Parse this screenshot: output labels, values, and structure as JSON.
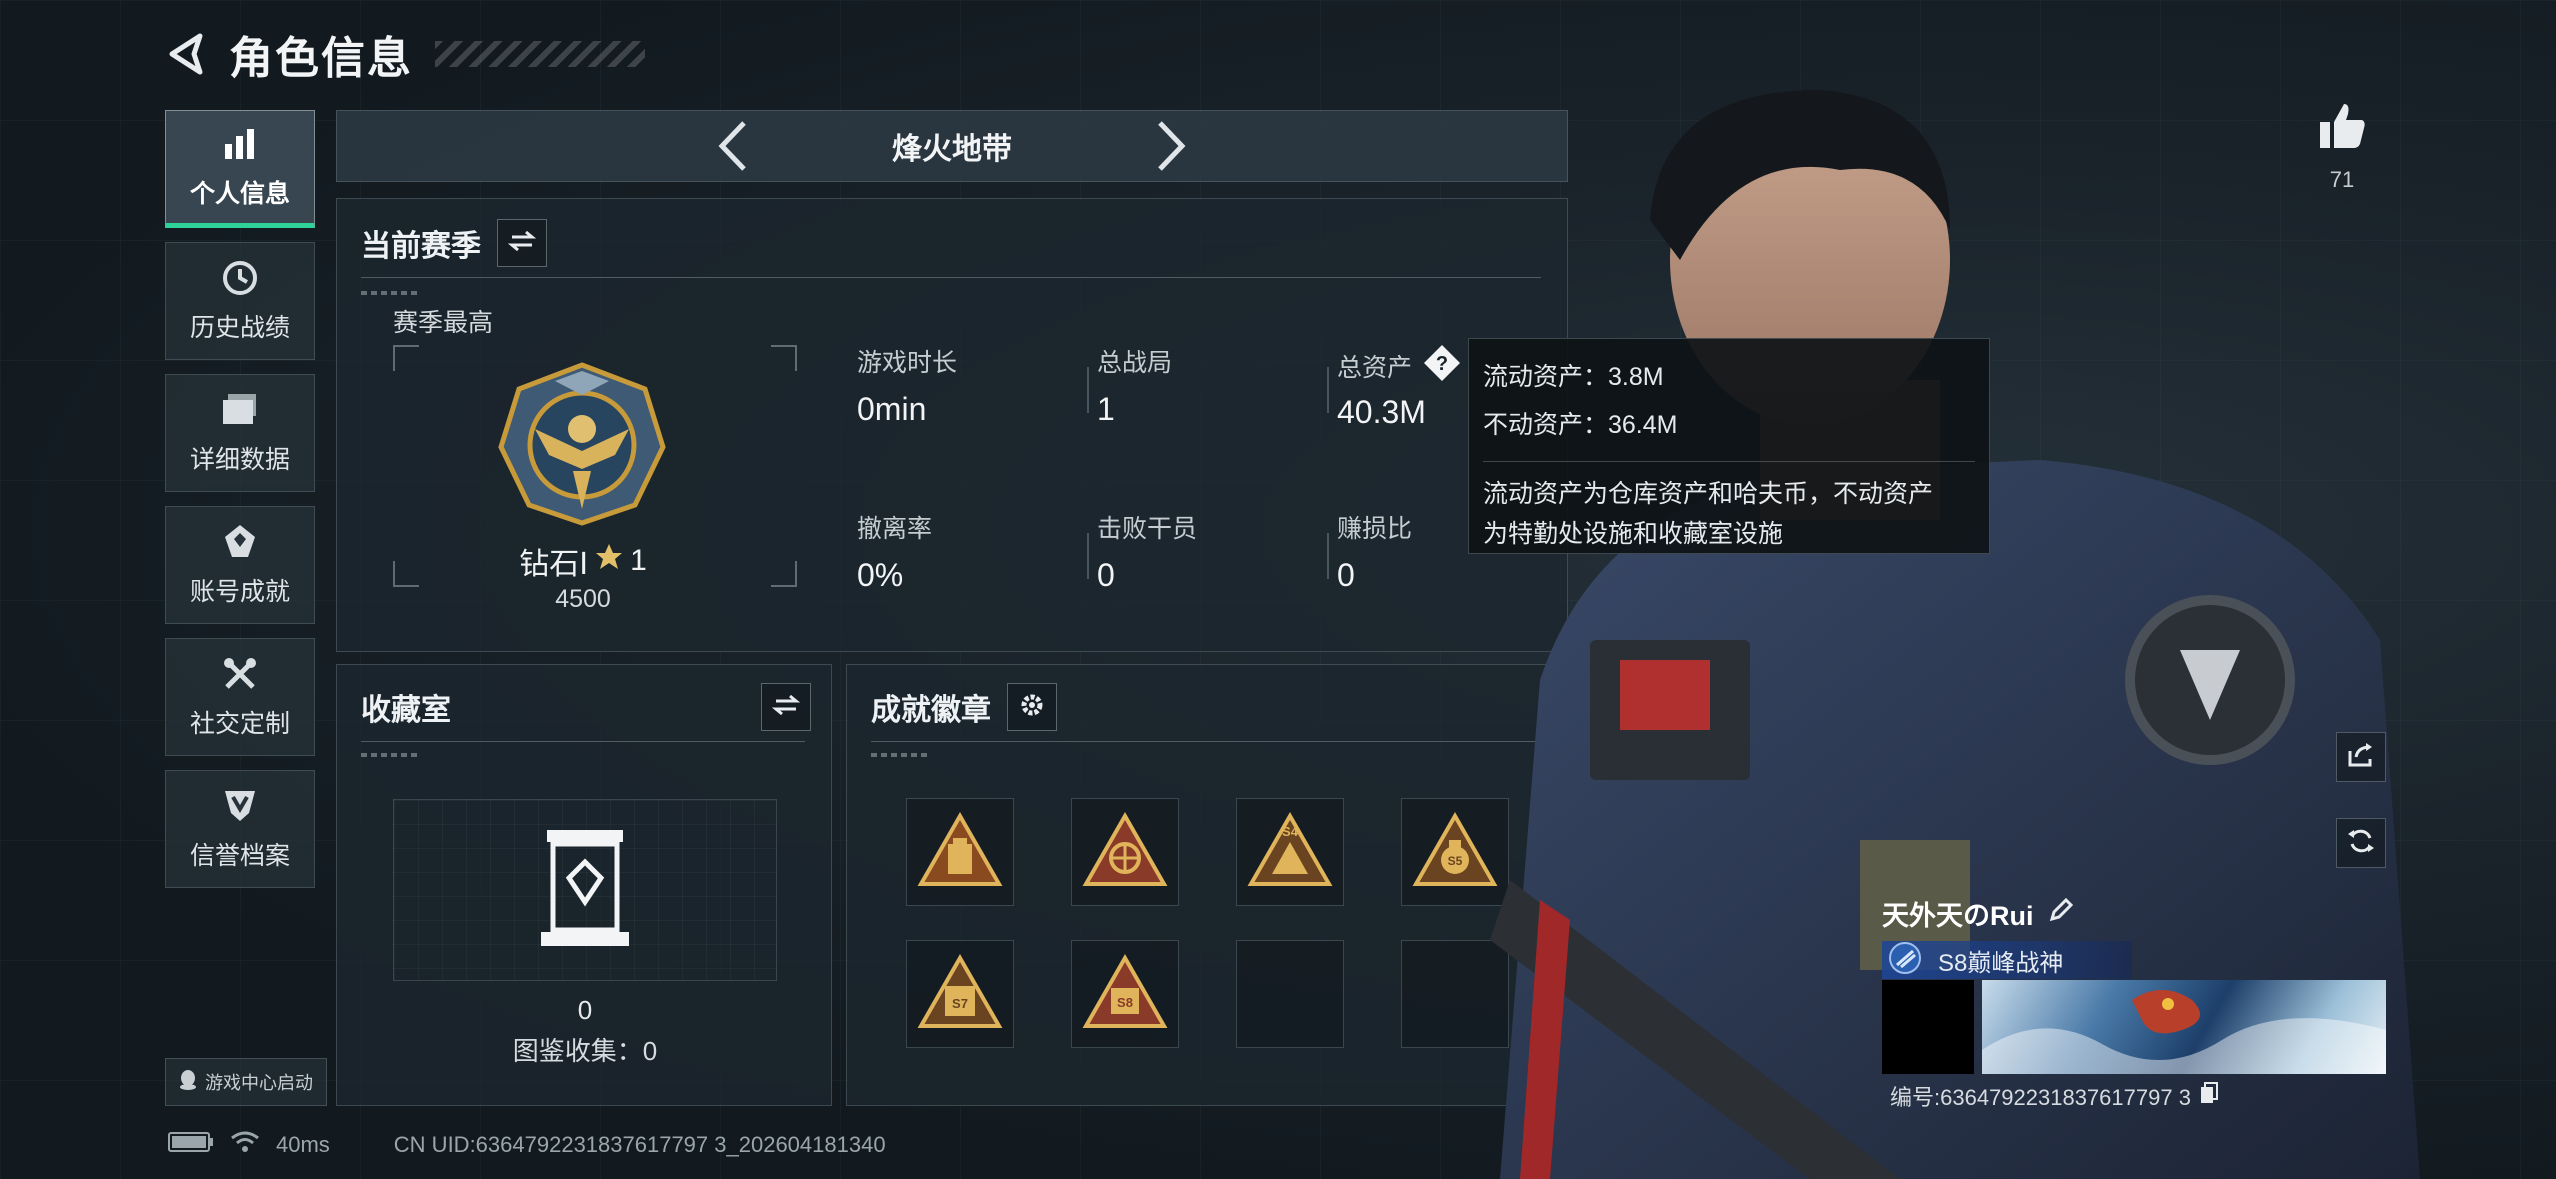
{
  "header": {
    "title": "角色信息"
  },
  "nav": {
    "items": [
      {
        "label": "个人信息",
        "icon": "bar-chart-icon",
        "active": true
      },
      {
        "label": "历史战绩",
        "icon": "clock-icon"
      },
      {
        "label": "详细数据",
        "icon": "folder-icon"
      },
      {
        "label": "账号成就",
        "icon": "achievement-icon"
      },
      {
        "label": "社交定制",
        "icon": "tools-icon"
      },
      {
        "label": "信誉档案",
        "icon": "shield-icon"
      }
    ],
    "launch_label": "游戏中心启动"
  },
  "mode": {
    "title": "烽火地带"
  },
  "season": {
    "title": "当前赛季",
    "subtitle": "赛季最高",
    "rank_name": "钻石Ⅰ",
    "rank_stars": "1",
    "rank_points": "4500",
    "stats": [
      {
        "label": "游戏时长",
        "value": "0min"
      },
      {
        "label": "总战局",
        "value": "1"
      },
      {
        "label": "总资产",
        "value": "40.3M"
      },
      {
        "label": "撤离率",
        "value": "0%"
      },
      {
        "label": "击败干员",
        "value": "0"
      },
      {
        "label": "赚损比",
        "value": "0"
      }
    ]
  },
  "tooltip": {
    "liquid": "流动资产：3.8M",
    "fixed": "不动资产：36.4M",
    "desc_line1": "流动资产为仓库资产和哈夫币，不动资产",
    "desc_line2": "为特勤处设施和收藏室设施"
  },
  "collection": {
    "title": "收藏室",
    "count": "0",
    "catalog": "图鉴收集：0"
  },
  "achievements": {
    "title": "成就徽章",
    "badges": [
      {
        "icon": "backpack-badge-icon",
        "filled": true
      },
      {
        "icon": "globe-badge-icon",
        "filled": true
      },
      {
        "icon": "s4-badge-icon",
        "filled": true,
        "text": "S4"
      },
      {
        "icon": "money-bag-badge-icon",
        "filled": true,
        "text": "S5"
      },
      {
        "icon": "calendar-badge-icon",
        "filled": true,
        "text": "S7"
      },
      {
        "icon": "s8-badge-icon",
        "filled": true,
        "text": "S8"
      },
      {
        "icon": "empty-slot",
        "filled": false
      },
      {
        "icon": "empty-slot",
        "filled": false
      }
    ]
  },
  "social": {
    "likes": "71"
  },
  "player": {
    "name": "天外天のRui",
    "rank_title": "S8巅峰战神",
    "id_text": "编号:6364792231837617797 3"
  },
  "status": {
    "ping": "40ms",
    "uid": "CN UID:6364792231837617797 3_202604181340"
  },
  "colors": {
    "accent": "#2fd39a",
    "gold": "#c79a3a",
    "rank_blue": "#1e4696"
  }
}
